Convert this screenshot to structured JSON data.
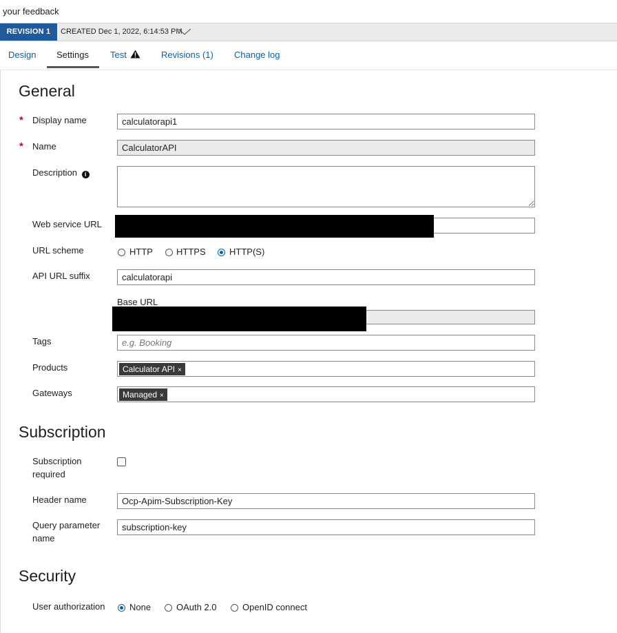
{
  "feedback": {
    "text": "your feedback"
  },
  "revision": {
    "badge": "REVISION 1",
    "created": "CREATED Dec 1, 2022, 6:14:53 PM"
  },
  "tabs": [
    {
      "label": "Design"
    },
    {
      "label": "Settings"
    },
    {
      "label": "Test"
    },
    {
      "label": "Revisions (1)"
    },
    {
      "label": "Change log"
    }
  ],
  "general": {
    "heading": "General",
    "display_name": {
      "label": "Display name",
      "value": "calculatorapi1"
    },
    "name": {
      "label": "Name",
      "value": "CalculatorAPI"
    },
    "description": {
      "label": "Description",
      "value": ""
    },
    "web_service_url": {
      "label": "Web service URL"
    },
    "url_scheme": {
      "label": "URL scheme",
      "options": [
        "HTTP",
        "HTTPS",
        "HTTP(S)"
      ],
      "selected": "HTTP(S)"
    },
    "api_url_suffix": {
      "label": "API URL suffix",
      "value": "calculatorapi"
    },
    "base_url": {
      "label": "Base URL"
    },
    "tags": {
      "label": "Tags",
      "placeholder": "e.g. Booking"
    },
    "products": {
      "label": "Products",
      "chip": "Calculator API",
      "remove": "×"
    },
    "gateways": {
      "label": "Gateways",
      "chip": "Managed",
      "remove": "×"
    }
  },
  "subscription": {
    "heading": "Subscription",
    "required_label_1": "Subscription",
    "required_label_2": "required",
    "header_name": {
      "label": "Header name",
      "value": "Ocp-Apim-Subscription-Key"
    },
    "query_param_label_1": "Query parameter",
    "query_param_label_2": "name",
    "query_param_value": "subscription-key"
  },
  "security": {
    "heading": "Security",
    "user_auth": {
      "label": "User authorization",
      "options": [
        "None",
        "OAuth 2.0",
        "OpenID connect"
      ],
      "selected": "None"
    }
  },
  "colors": {
    "accent": "#0063b1",
    "badge": "#1e5a9c",
    "required": "#d0021b"
  },
  "icons": {
    "revision_chevron": "chevron-down-icon",
    "test_warning": "warning-icon",
    "description_info": "info-icon"
  }
}
